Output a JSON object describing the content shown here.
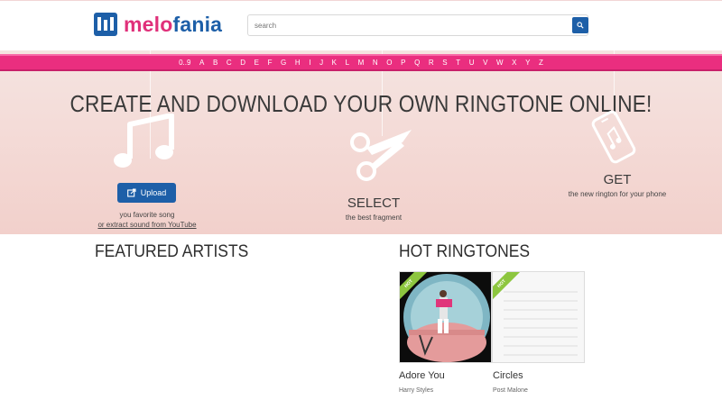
{
  "logo": {
    "part1": "melo",
    "part2": "fania"
  },
  "search": {
    "placeholder": "search",
    "value": ""
  },
  "alphabet": [
    "0..9",
    "A",
    "B",
    "C",
    "D",
    "E",
    "F",
    "G",
    "H",
    "I",
    "J",
    "K",
    "L",
    "M",
    "N",
    "O",
    "P",
    "Q",
    "R",
    "S",
    "T",
    "U",
    "V",
    "W",
    "X",
    "Y",
    "Z"
  ],
  "hero": {
    "title": "CREATE AND DOWNLOAD YOUR OWN RINGTONE ONLINE!",
    "upload_label": "Upload",
    "upload_caption_1": "you favorite song",
    "upload_caption_2": "or extract sound from YouTube",
    "select_label": "SELECT",
    "select_caption": "the best fragment",
    "get_label": "GET",
    "get_caption": "the new rington for your phone"
  },
  "sections": {
    "featured": "FEATURED ARTISTS",
    "hot": "HOT RINGTONES"
  },
  "hot_ringtones": [
    {
      "title": "Adore You",
      "artist": "Harry Styles",
      "badge": "HOT"
    },
    {
      "title": "Circles",
      "artist": "Post Malone",
      "badge": "HOT"
    }
  ],
  "colors": {
    "brand_blue": "#1d5fa8",
    "brand_pink": "#e0307a",
    "alpha_bar": "#ea2e7f",
    "hot_badge": "#8dc63f"
  }
}
